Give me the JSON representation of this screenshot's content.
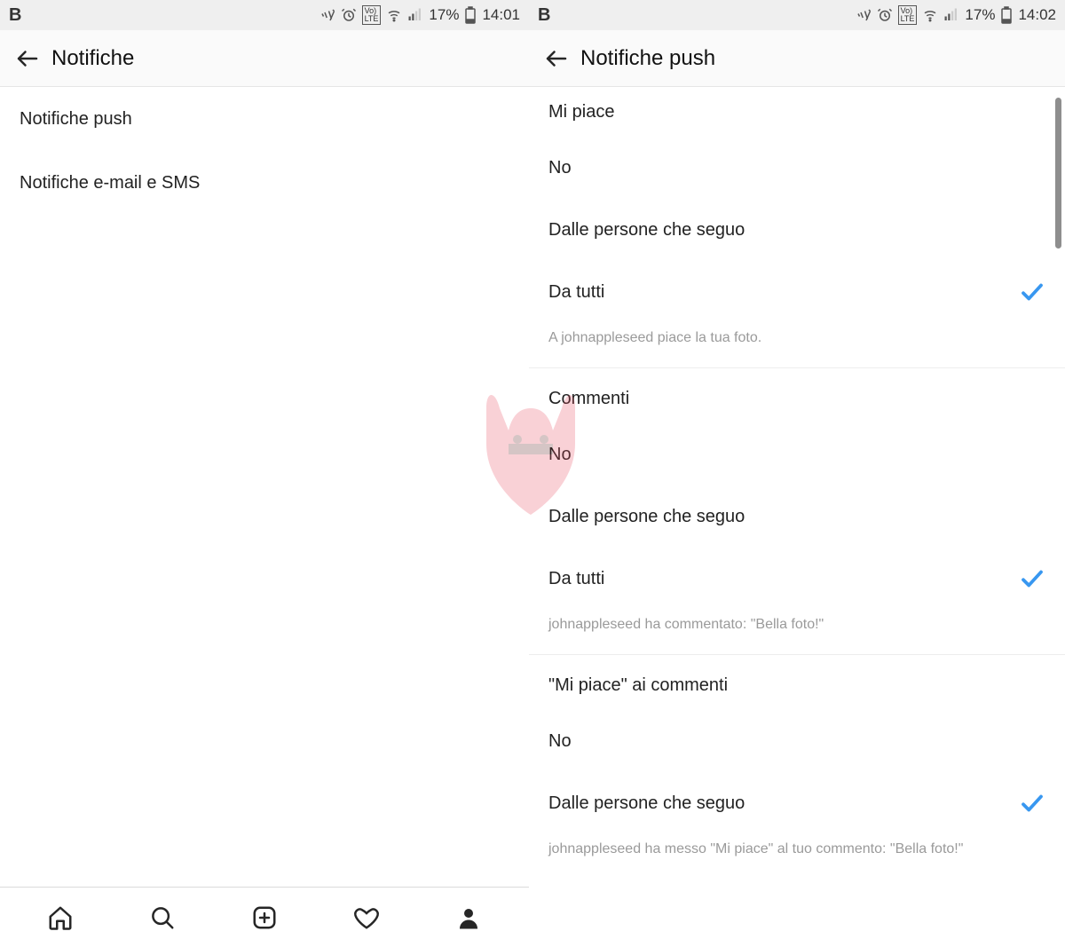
{
  "status": {
    "left": "B",
    "battery": "17%",
    "time_a": "14:01",
    "time_b": "14:02"
  },
  "headers": {
    "a_title": "Notifiche",
    "b_title": "Notifiche push"
  },
  "screen_a": {
    "items": [
      "Notifiche push",
      "Notifiche e-mail e SMS"
    ]
  },
  "screen_b": {
    "sec1": {
      "title": "Mi piace",
      "opt0": "No",
      "opt1": "Dalle persone che seguo",
      "opt2": "Da tutti",
      "preview": "A johnappleseed piace la tua foto."
    },
    "sec2": {
      "title": "Commenti",
      "opt0": "No",
      "opt1": "Dalle persone che seguo",
      "opt2": "Da tutti",
      "preview": "johnappleseed ha commentato: \"Bella foto!\""
    },
    "sec3": {
      "title": "\"Mi piace\" ai commenti",
      "opt0": "No",
      "opt1": "Dalle persone che seguo",
      "preview": "johnappleseed ha messo \"Mi piace\" al tuo commento: \"Bella foto!\""
    }
  }
}
